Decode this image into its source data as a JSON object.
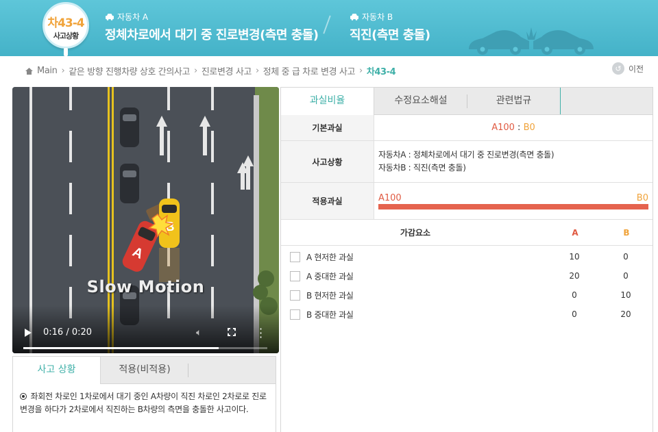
{
  "header": {
    "badge_code": "차43-4",
    "badge_sub": "사고상황",
    "car_a_label": "자동차 A",
    "car_a_title": "정체차로에서 대기 중 진로변경(측면 충돌)",
    "car_b_label": "자동차 B",
    "car_b_title": "직진(측면 충돌)"
  },
  "breadcrumb": {
    "home": "Main",
    "items": [
      "같은 방향 진행차량 상호 간의사고",
      "진로변경 사고",
      "정체 중 급 차로 변경 사고"
    ],
    "current": "차43-4",
    "prev_label": "이전"
  },
  "video": {
    "overlay_text": "Slow Motion",
    "car_a_mark": "A",
    "car_b_mark": "B",
    "time": "0:16 / 0:20",
    "progress": 0.8
  },
  "left_panel": {
    "tabs": [
      "사고 상황",
      "적용(비적용)"
    ],
    "description": "좌회전 차로인 1차로에서 대기 중인 A차량이 직진 차로인 2차로로 진로변경을 하다가 2차로에서 직진하는 B차량의 측면을 충돌한 사고이다."
  },
  "right_panel": {
    "tabs": [
      "과실비율",
      "수정요소해설",
      "관련법규"
    ],
    "basic_fault_label": "기본과실",
    "basic_fault_a": "A100",
    "basic_fault_sep": " : ",
    "basic_fault_b": "B0",
    "situation_label": "사고상황",
    "situation_a": "자동차A : 정체차로에서 대기 중 진로변경(측면 충돌)",
    "situation_b": "자동차B : 직진(측면 충돌)",
    "applied_label": "적용과실",
    "applied_a": "A100",
    "applied_b": "B0",
    "applied_ratio_a": 1.0,
    "adjust_header": "가감요소",
    "col_a": "A",
    "col_b": "B",
    "factors": [
      {
        "name": "A 현저한 과실",
        "a": "10",
        "b": "0"
      },
      {
        "name": "A 중대한 과실",
        "a": "20",
        "b": "0"
      },
      {
        "name": "B 현저한 과실",
        "a": "0",
        "b": "10"
      },
      {
        "name": "B 중대한 과실",
        "a": "0",
        "b": "20"
      }
    ]
  },
  "colors": {
    "header": "#4fbcd0",
    "accent": "#3fb0a8",
    "fault_a": "#e05a42",
    "fault_b": "#f0a33a"
  }
}
